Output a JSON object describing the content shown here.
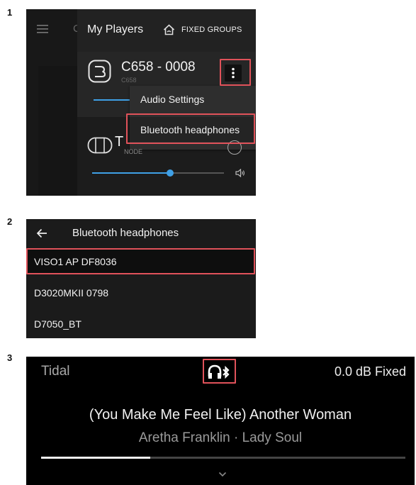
{
  "steps": [
    "1",
    "2",
    "3"
  ],
  "panel1": {
    "sidebar_clipped_char": "C",
    "title": "My Players",
    "fixed_groups_label": "FIXED GROUPS",
    "player1": {
      "name": "C658 - 0008",
      "model": "C658"
    },
    "menu": {
      "items": [
        "Audio Settings",
        "Bluetooth headphones"
      ]
    },
    "player2": {
      "name_clipped": "T",
      "model": "NODE",
      "volume": 0.59
    }
  },
  "panel2": {
    "title": "Bluetooth headphones",
    "devices": [
      "VISO1 AP DF8036",
      "D3020MKII 0798",
      "D7050_BT"
    ]
  },
  "panel3": {
    "source": "Tidal",
    "volume_label": "0.0 dB Fixed",
    "track_title": "(You Make Me Feel Like) Another Woman",
    "artist_album": "Aretha Franklin · Lady Soul",
    "progress": 0.3
  },
  "colors": {
    "accent": "#3fa0e6",
    "highlight": "#e0525a",
    "panel_bg": "#1b1b1b",
    "menu_bg": "#2d2d2d"
  }
}
